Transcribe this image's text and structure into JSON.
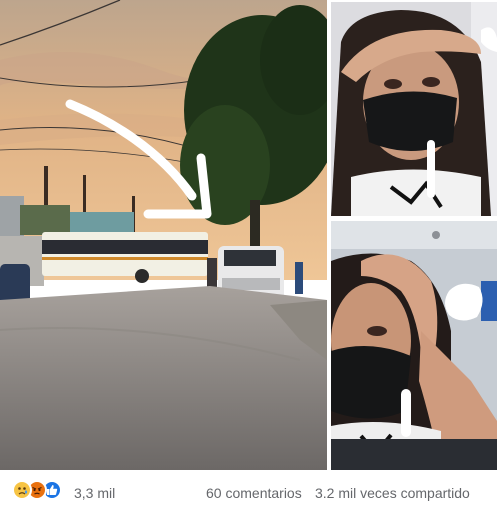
{
  "footer": {
    "reaction_count": "3,3 mil",
    "comments": "60 comentarios",
    "shares": "3.2 mil veces compartido",
    "reaction_icons": [
      "sad-face-icon",
      "angry-face-icon",
      "like-thumb-icon"
    ]
  },
  "photos": {
    "main": {
      "subject": "street-with-bus-and-suv",
      "annotation": "white-arrow"
    },
    "top": {
      "subject": "selfie-woman-hand-on-head"
    },
    "bottom": {
      "subject": "selfie-woman-hand-on-head"
    }
  },
  "colors": {
    "text_secondary": "#65676b",
    "like_blue": "#1b74e4",
    "sad_yellow": "#f7c444",
    "angry_orange": "#e9710f",
    "bus_body": "#f2f0e4",
    "bus_stripe": "#d08a2c"
  }
}
